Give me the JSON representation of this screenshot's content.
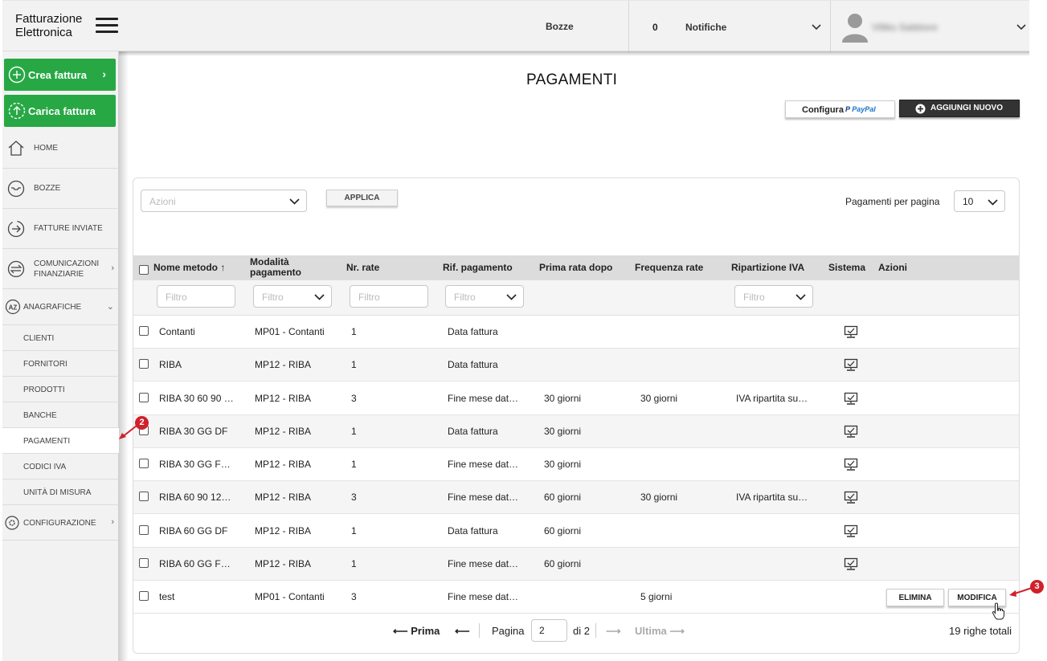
{
  "header": {
    "logo_line1": "Fatturazione",
    "logo_line2": "Elettronica",
    "bozze": "Bozze",
    "notif_count": "0",
    "notifiche": "Notifiche",
    "username": "Villiks Sabbiore"
  },
  "sidebar": {
    "crea": "Crea fattura",
    "carica": "Carica fattura",
    "items": [
      {
        "label": "HOME"
      },
      {
        "label": "BOZZE"
      },
      {
        "label": "FATTURE INVIATE"
      },
      {
        "label": "COMUNICAZIONI FINANZIARIE"
      },
      {
        "label": "ANAGRAFICHE"
      }
    ],
    "sub": [
      "CLIENTI",
      "FORNITORI",
      "PRODOTTI",
      "BANCHE",
      "PAGAMENTI",
      "CODICI IVA",
      "UNITÀ DI MISURA"
    ],
    "config": "CONFIGURAZIONE"
  },
  "main": {
    "title": "PAGAMENTI",
    "configura": "Configura",
    "paypal": "PayPal",
    "aggiungi": "AGGIUNGI NUOVO",
    "azioni_placeholder": "Azioni",
    "applica": "APPLICA",
    "per_page_label": "Pagamenti per pagina",
    "per_page_value": "10",
    "filter_placeholder": "Filtro"
  },
  "table": {
    "headers": {
      "nome": "Nome metodo",
      "nome_sort": "↑",
      "modalita_1": "Modalità",
      "modalita_2": "pagamento",
      "nr_rate": "Nr. rate",
      "rif": "Rif. pagamento",
      "prima": "Prima rata dopo",
      "freq": "Frequenza rate",
      "iva": "Ripartizione IVA",
      "sistema": "Sistema",
      "azioni": "Azioni"
    },
    "rows": [
      {
        "nome": "Contanti",
        "modalita": "MP01 - Contanti",
        "nr": "1",
        "rif": "Data fattura",
        "prima": "",
        "freq": "",
        "iva": "",
        "sistema": true
      },
      {
        "nome": "RIBA",
        "modalita": "MP12 - RIBA",
        "nr": "1",
        "rif": "Data fattura",
        "prima": "",
        "freq": "",
        "iva": "",
        "sistema": true
      },
      {
        "nome": "RIBA 30 60 90 …",
        "modalita": "MP12 - RIBA",
        "nr": "3",
        "rif": "Fine mese dat…",
        "prima": "30 giorni",
        "freq": "30 giorni",
        "iva": "IVA ripartita su…",
        "sistema": true
      },
      {
        "nome": "RIBA 30 GG DF",
        "modalita": "MP12 - RIBA",
        "nr": "1",
        "rif": "Data fattura",
        "prima": "30 giorni",
        "freq": "",
        "iva": "",
        "sistema": true
      },
      {
        "nome": "RIBA 30 GG F…",
        "modalita": "MP12 - RIBA",
        "nr": "1",
        "rif": "Fine mese dat…",
        "prima": "30 giorni",
        "freq": "",
        "iva": "",
        "sistema": true
      },
      {
        "nome": "RIBA 60 90 12…",
        "modalita": "MP12 - RIBA",
        "nr": "3",
        "rif": "Fine mese dat…",
        "prima": "60 giorni",
        "freq": "30 giorni",
        "iva": "IVA ripartita su…",
        "sistema": true
      },
      {
        "nome": "RIBA 60 GG DF",
        "modalita": "MP12 - RIBA",
        "nr": "1",
        "rif": "Data fattura",
        "prima": "60 giorni",
        "freq": "",
        "iva": "",
        "sistema": true
      },
      {
        "nome": "RIBA 60 GG F…",
        "modalita": "MP12 - RIBA",
        "nr": "1",
        "rif": "Fine mese dat…",
        "prima": "60 giorni",
        "freq": "",
        "iva": "",
        "sistema": true
      },
      {
        "nome": "test",
        "modalita": "MP01 - Contanti",
        "nr": "3",
        "rif": "Fine mese dat…",
        "prima": "",
        "freq": "5 giorni",
        "iva": "",
        "sistema": false
      }
    ],
    "elimina": "ELIMINA",
    "modifica": "MODIFICA"
  },
  "pager": {
    "prima": "Prima",
    "pagina": "Pagina",
    "page": "2",
    "of": "di 2",
    "ultima": "Ultima",
    "totale": "19 righe totali"
  },
  "badges": {
    "b2": "2",
    "b3": "3"
  },
  "colors": {
    "green": "#27a845",
    "dark": "#333333",
    "badge": "#d0202a"
  }
}
